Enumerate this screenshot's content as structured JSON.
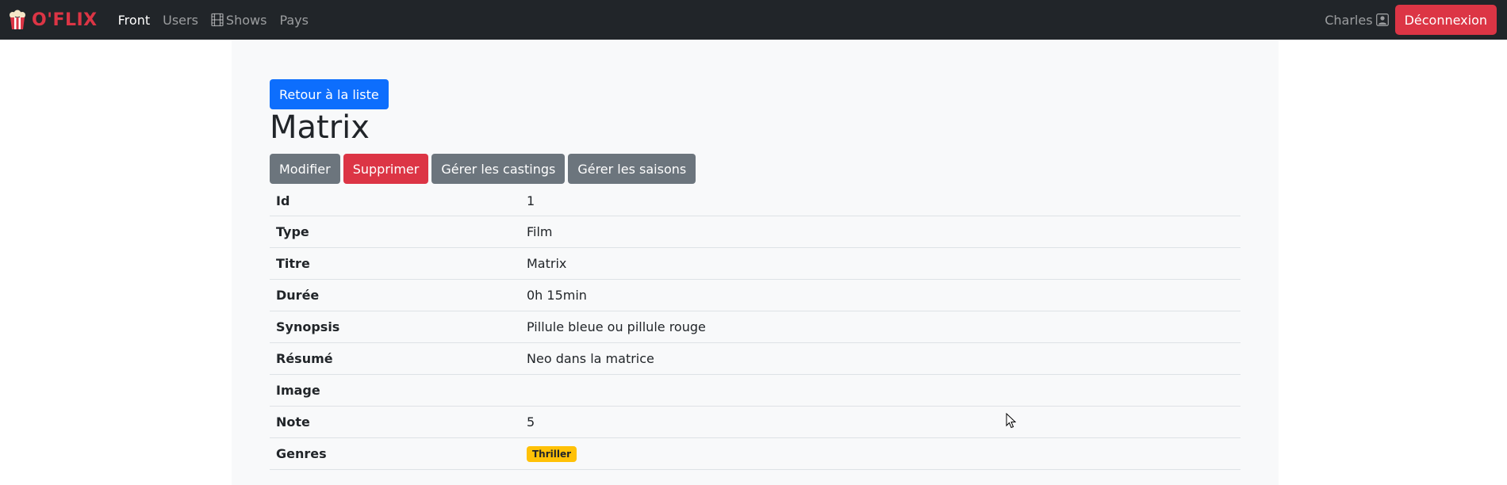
{
  "navbar": {
    "brand": "O'FLIX",
    "links": [
      "Front",
      "Users",
      "Shows",
      "Pays"
    ],
    "user": "Charles",
    "logout": "Déconnexion"
  },
  "page": {
    "back_button": "Retour à la liste",
    "title": "Matrix",
    "actions": {
      "edit": "Modifier",
      "delete": "Supprimer",
      "castings": "Gérer les castings",
      "seasons": "Gérer les saisons"
    }
  },
  "details": [
    {
      "key": "Id",
      "value": "1"
    },
    {
      "key": "Type",
      "value": "Film"
    },
    {
      "key": "Titre",
      "value": "Matrix"
    },
    {
      "key": "Durée",
      "value": "0h 15min"
    },
    {
      "key": "Synopsis",
      "value": "Pillule bleue ou pillule rouge"
    },
    {
      "key": "Résumé",
      "value": "Neo dans la matrice"
    },
    {
      "key": "Image",
      "value": ""
    },
    {
      "key": "Note",
      "value": "5"
    },
    {
      "key": "Genres",
      "value": ""
    }
  ],
  "genres": [
    "Thriller"
  ],
  "colors": {
    "navbar_bg": "#212529",
    "brand": "#dc3545",
    "primary": "#0d6efd",
    "secondary": "#6c757d",
    "danger": "#dc3545",
    "badge_warning": "#ffc107"
  },
  "icons": {
    "brand": "popcorn-icon",
    "shows": "film-icon",
    "user": "person-square-icon"
  }
}
